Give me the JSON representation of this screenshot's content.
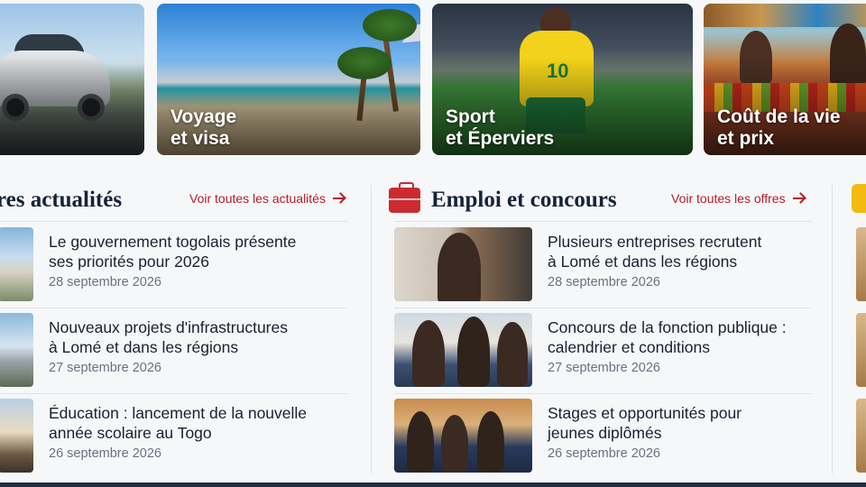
{
  "categories": [
    {
      "id": "car",
      "line1": "",
      "line2": ""
    },
    {
      "id": "voyage",
      "line1": "Voyage",
      "line2": "et visa"
    },
    {
      "id": "sport",
      "line1": "Sport",
      "line2": "et Éperviers",
      "jersey_number": "10"
    },
    {
      "id": "vie",
      "line1": "Coût de la vie",
      "line2": "et prix"
    }
  ],
  "news": {
    "title": "res actualités",
    "see_all": "Voir toutes les actualités",
    "items": [
      {
        "title_line1": "Le gouvernement togolais présente",
        "title_line2": "ses priorités pour 2026",
        "date": "28 septembre 2026"
      },
      {
        "title_line1": "Nouveaux projets d'infrastructures",
        "title_line2": "à Lomé et dans les régions",
        "date": "27 septembre 2026"
      },
      {
        "title_line1": "Éducation : lancement de la nouvelle",
        "title_line2": "année scolaire au Togo",
        "date": "26 septembre 2026"
      }
    ]
  },
  "jobs": {
    "title": "Emploi et concours",
    "see_all": "Voir toutes les offres",
    "icon": "briefcase-icon",
    "icon_color": "#cc2a30",
    "items": [
      {
        "title_line1": "Plusieurs entreprises recrutent",
        "title_line2": "à Lomé et dans les régions",
        "date": "28 septembre 2026"
      },
      {
        "title_line1": "Concours de la fonction publique :",
        "title_line2": "calendrier et conditions",
        "date": "27 septembre 2026"
      },
      {
        "title_line1": "Stages et opportunités pour",
        "title_line2": "jeunes diplômés",
        "date": "26 septembre 2026"
      }
    ]
  },
  "colors": {
    "accent_red": "#b3202a",
    "heading_navy": "#16223a",
    "date_gray": "#6a7180",
    "footer_bar": "#1f2c48",
    "partial_icon_yellow": "#f2b90f"
  }
}
